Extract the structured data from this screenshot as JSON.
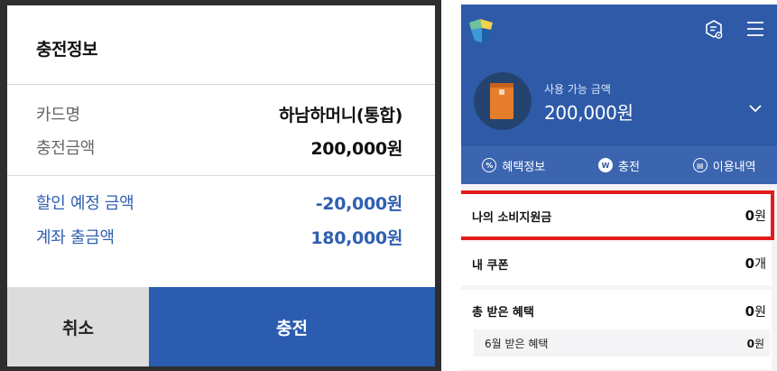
{
  "dialog": {
    "title": "충전정보",
    "rows": [
      {
        "label": "카드명",
        "value": "하남하머니(통합)"
      },
      {
        "label": "충전금액",
        "value": "200,000원"
      }
    ],
    "summary": [
      {
        "label": "할인 예정 금액",
        "value": "-20,000원"
      },
      {
        "label": "계좌 출금액",
        "value": "180,000원"
      }
    ],
    "cancel_label": "취소",
    "charge_label": "충전"
  },
  "app": {
    "balance_label": "사용 가능 금액",
    "balance_amount": "200,000원",
    "tabs": [
      {
        "icon": "percent-icon",
        "label": "혜택정보"
      },
      {
        "icon": "won-icon",
        "label": "충전"
      },
      {
        "icon": "history-icon",
        "label": "이용내역"
      }
    ],
    "list": {
      "spending_support": {
        "label": "나의 소비지원금",
        "value": "0",
        "unit": "원"
      },
      "coupons": {
        "label": "내 쿠폰",
        "value": "0",
        "unit": "개"
      },
      "total_benefit": {
        "label": "총 받은 혜택",
        "value": "0",
        "unit": "원"
      },
      "monthly_benefit": {
        "label": "6월 받은 혜택",
        "value": "0",
        "unit": "원"
      }
    },
    "colors": {
      "primary": "#2e5aa8",
      "highlight": "#e31b1b",
      "card": "#e67d2c"
    }
  }
}
